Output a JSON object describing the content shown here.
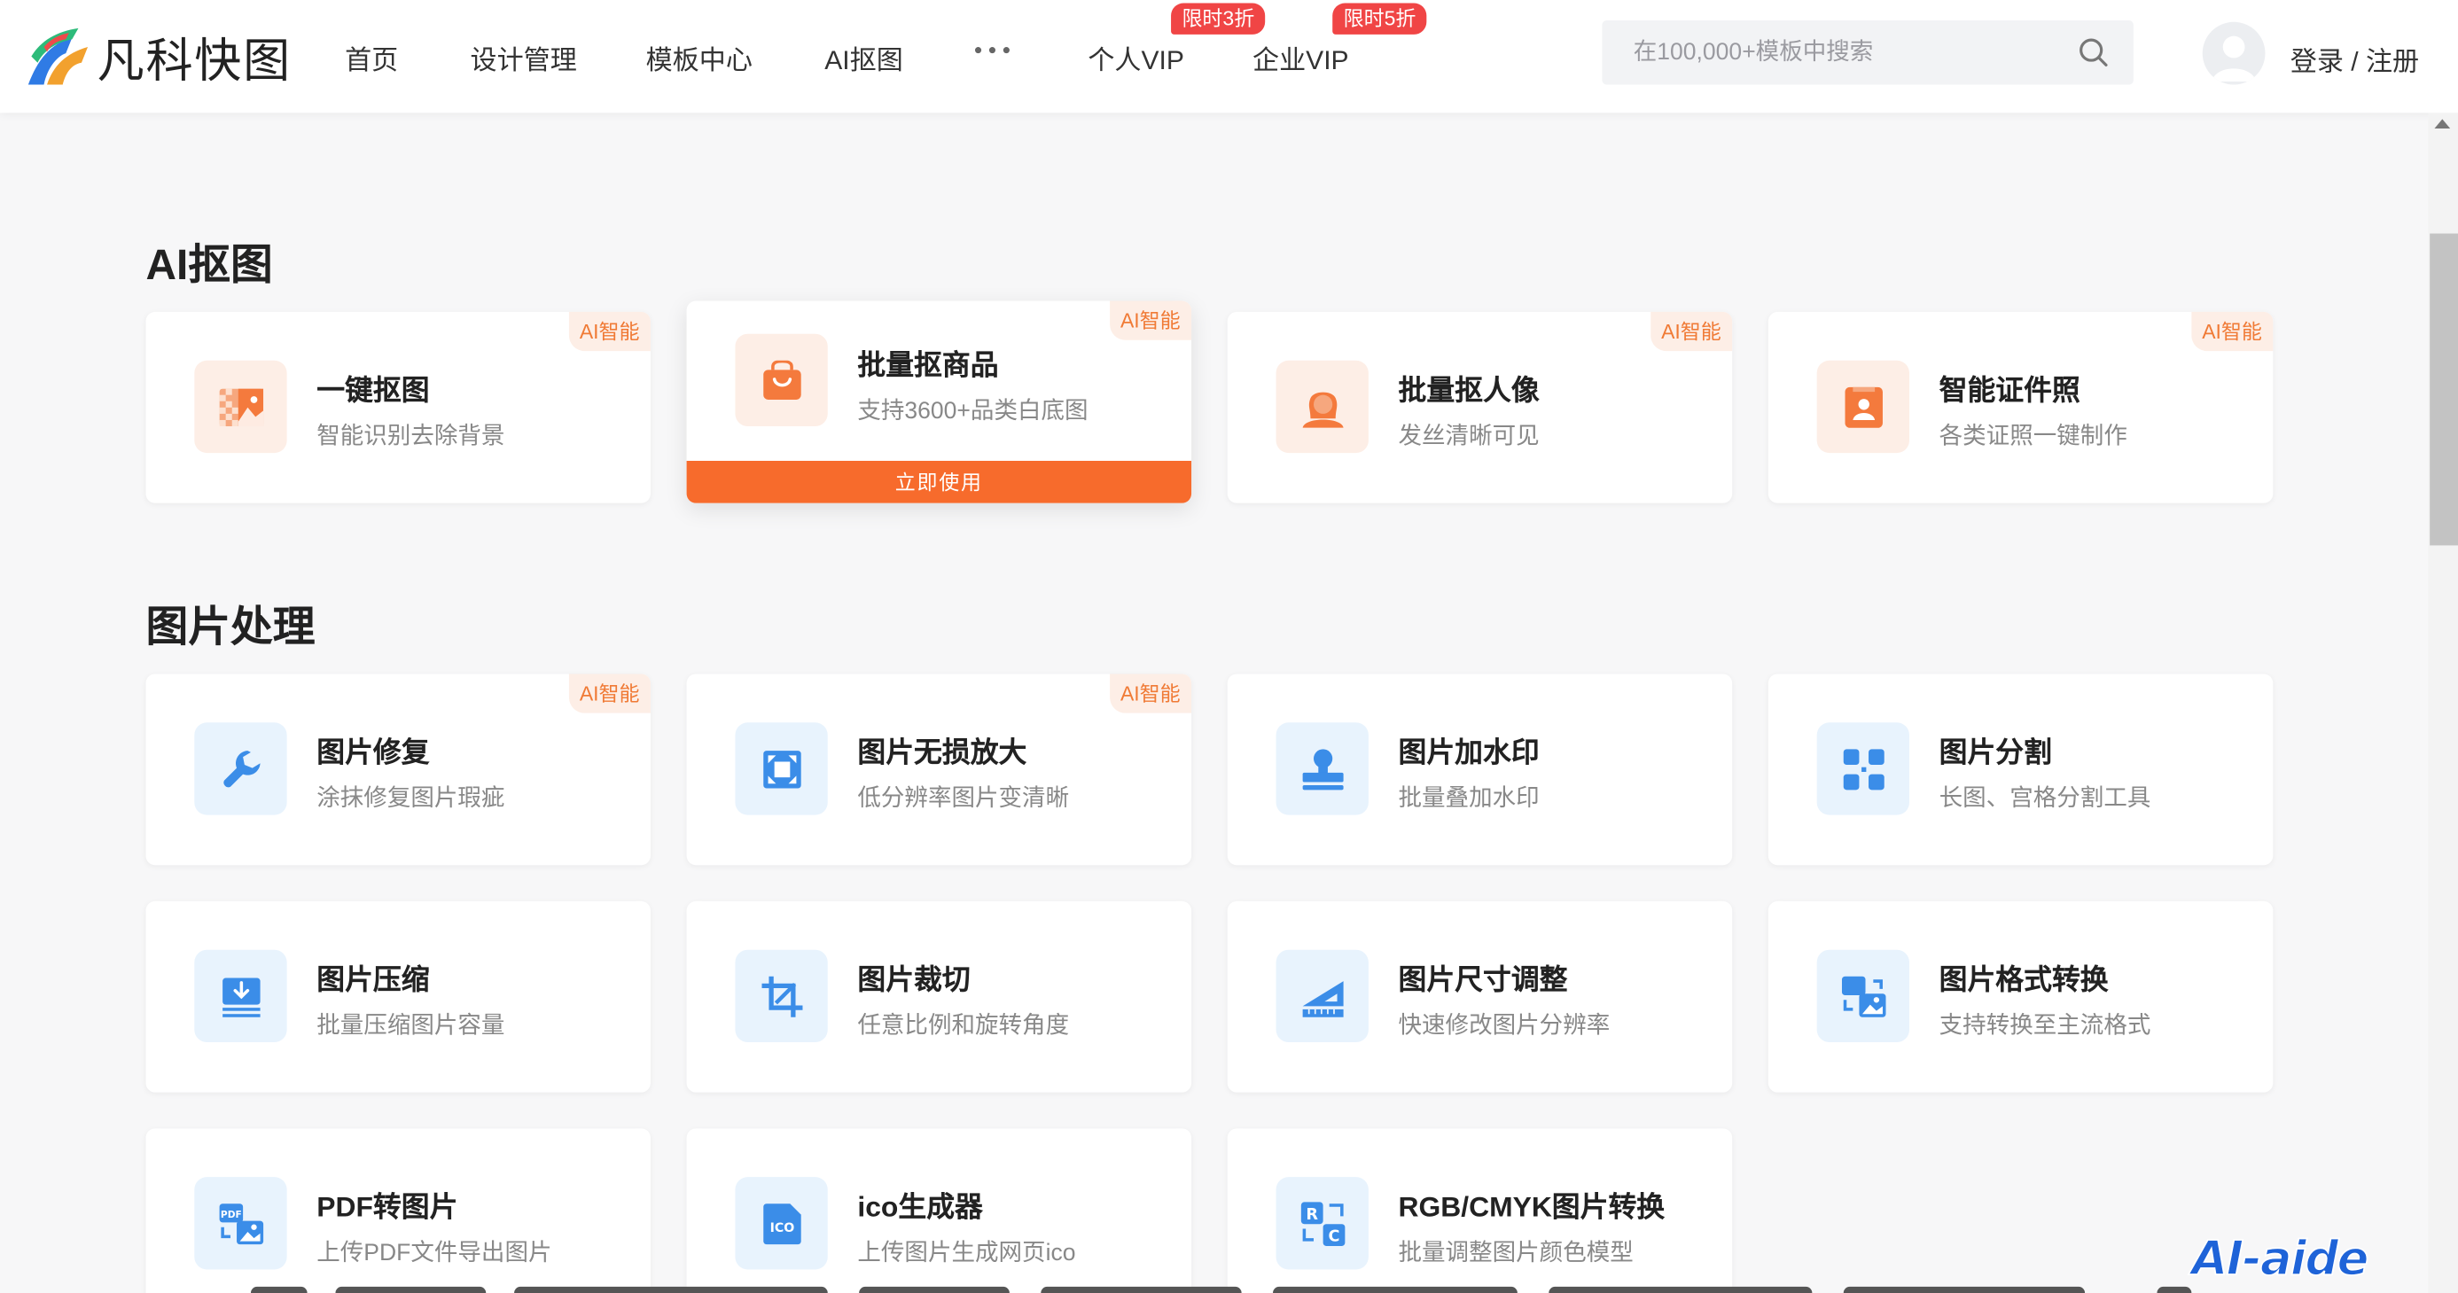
{
  "brand": {
    "logo_text": "凡科快图",
    "accent": "#f76b2c",
    "promo_color": "#f04545",
    "blue_icon_color": "#3b8de8"
  },
  "nav": {
    "items": [
      "首页",
      "设计管理",
      "模板中心",
      "AI抠图"
    ],
    "more_icon": "ellipsis-icon",
    "vip_personal": "个人VIP",
    "vip_personal_badge": "限时3折",
    "vip_enterprise": "企业VIP",
    "vip_enterprise_badge": "限时5折"
  },
  "search": {
    "placeholder": "在100,000+模板中搜索",
    "icon": "search-icon"
  },
  "user": {
    "login_label": "登录 / 注册",
    "avatar_icon": "user-avatar-icon"
  },
  "sections": {
    "ai": {
      "title": "AI抠图",
      "cards": [
        {
          "title": "一键抠图",
          "desc": "智能识别去除背景",
          "badge": "AI智能",
          "icon": "image-cutout-icon"
        },
        {
          "title": "批量抠商品",
          "desc": "支持3600+品类白底图",
          "badge": "AI智能",
          "icon": "shopping-bag-icon",
          "action": "立即使用"
        },
        {
          "title": "批量抠人像",
          "desc": "发丝清晰可见",
          "badge": "AI智能",
          "icon": "portrait-icon"
        },
        {
          "title": "智能证件照",
          "desc": "各类证照一键制作",
          "badge": "AI智能",
          "icon": "id-photo-icon"
        }
      ]
    },
    "process": {
      "title": "图片处理",
      "cards": [
        {
          "title": "图片修复",
          "desc": "涂抹修复图片瑕疵",
          "badge": "AI智能",
          "icon": "wrench-icon"
        },
        {
          "title": "图片无损放大",
          "desc": "低分辨率图片变清晰",
          "badge": "AI智能",
          "icon": "enlarge-icon"
        },
        {
          "title": "图片加水印",
          "desc": "批量叠加水印",
          "badge": "",
          "icon": "stamp-icon"
        },
        {
          "title": "图片分割",
          "desc": "长图、宫格分割工具",
          "badge": "",
          "icon": "grid-split-icon"
        },
        {
          "title": "图片压缩",
          "desc": "批量压缩图片容量",
          "badge": "",
          "icon": "compress-icon"
        },
        {
          "title": "图片裁切",
          "desc": "任意比例和旋转角度",
          "badge": "",
          "icon": "crop-icon"
        },
        {
          "title": "图片尺寸调整",
          "desc": "快速修改图片分辨率",
          "badge": "",
          "icon": "ruler-icon"
        },
        {
          "title": "图片格式转换",
          "desc": "支持转换至主流格式",
          "badge": "",
          "icon": "format-convert-icon"
        },
        {
          "title": "PDF转图片",
          "desc": "上传PDF文件导出图片",
          "badge": "",
          "icon": "pdf-to-image-icon"
        },
        {
          "title": "ico生成器",
          "desc": "上传图片生成网页ico",
          "badge": "",
          "icon": "ico-icon"
        },
        {
          "title": "RGB/CMYK图片转换",
          "desc": "批量调整图片颜色模型",
          "badge": "",
          "icon": "color-model-icon"
        }
      ]
    }
  },
  "watermark": "AI-aide"
}
